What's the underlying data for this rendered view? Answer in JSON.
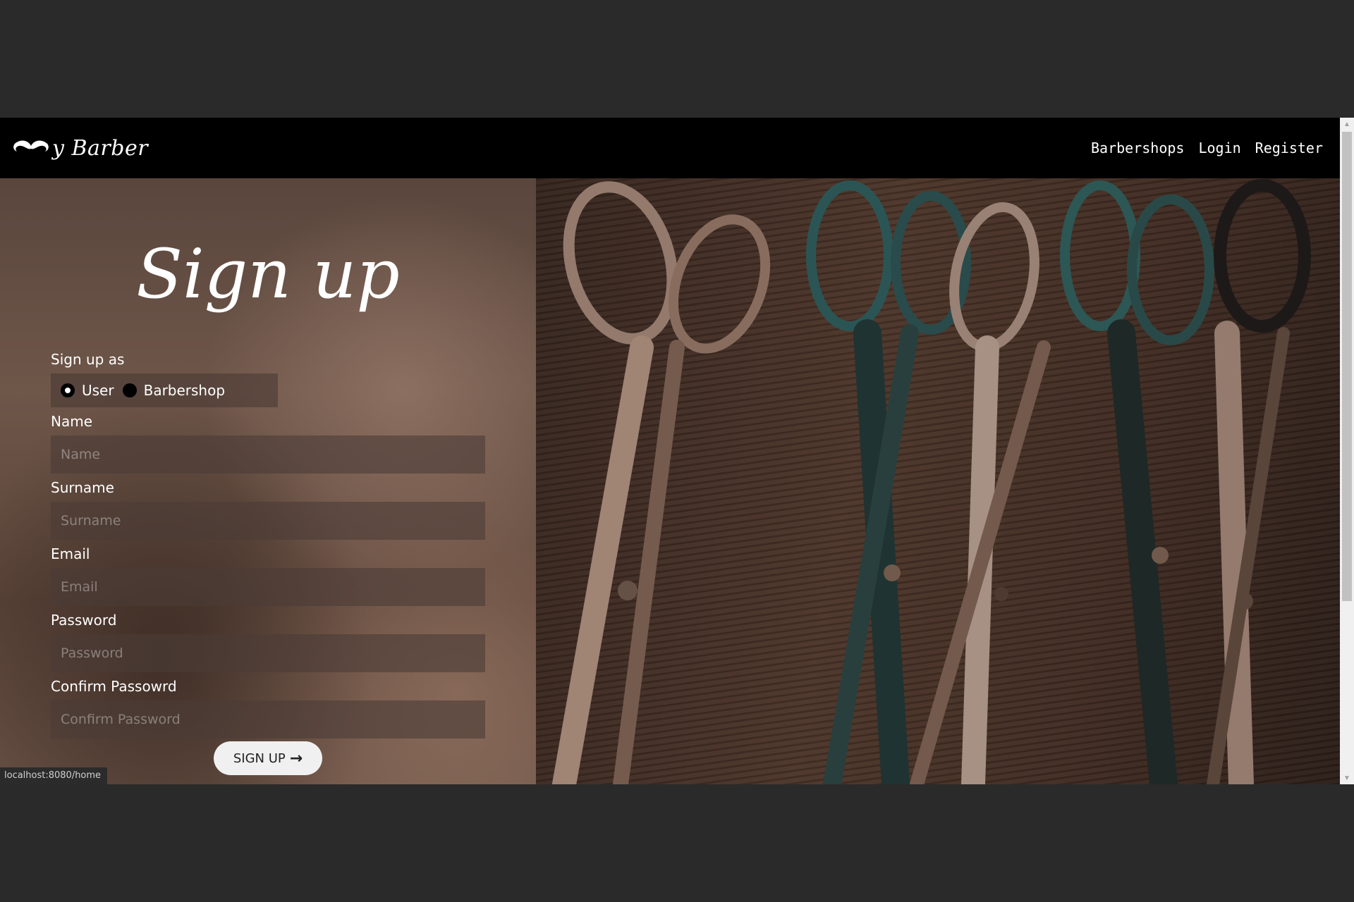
{
  "navbar": {
    "logo_text": "y Barber",
    "links": [
      "Barbershops",
      "Login",
      "Register"
    ]
  },
  "page": {
    "title": "Sign up"
  },
  "form": {
    "role_label": "Sign up as",
    "roles": [
      {
        "label": "User",
        "selected": true
      },
      {
        "label": "Barbershop",
        "selected": false
      }
    ],
    "fields": [
      {
        "label": "Name",
        "placeholder": "Name"
      },
      {
        "label": "Surname",
        "placeholder": "Surname"
      },
      {
        "label": "Email",
        "placeholder": "Email"
      },
      {
        "label": "Password",
        "placeholder": "Password"
      },
      {
        "label": "Confirm Passowrd",
        "placeholder": "Confirm Password"
      }
    ],
    "submit_label": "SIGN UP"
  },
  "status_bar": {
    "url": "localhost:8080/home"
  }
}
